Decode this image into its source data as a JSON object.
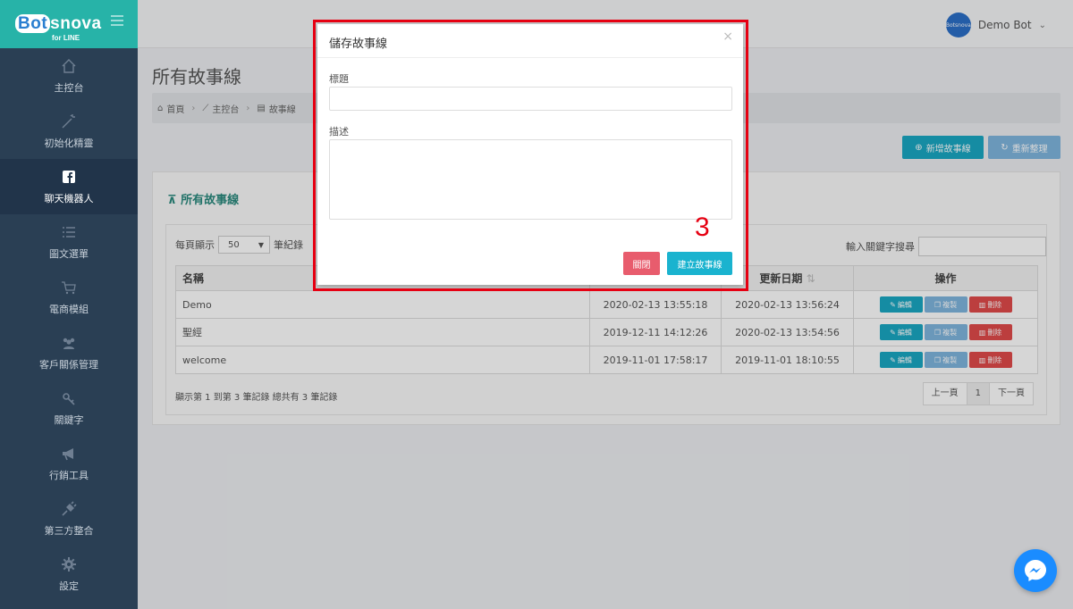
{
  "brand": {
    "logo_prefix": "Bot",
    "logo_rest": "snova",
    "logo_sub": "for LINE"
  },
  "sidebar": {
    "items": [
      {
        "label": "主控台",
        "icon": "home-icon"
      },
      {
        "label": "初始化精靈",
        "icon": "magic-wand-icon"
      },
      {
        "label": "聊天機器人",
        "icon": "facebook-square-icon",
        "active": true
      },
      {
        "label": "圖文選單",
        "icon": "list-icon"
      },
      {
        "label": "電商模組",
        "icon": "cart-icon"
      },
      {
        "label": "客戶關係管理",
        "icon": "users-icon"
      },
      {
        "label": "關鍵字",
        "icon": "key-icon"
      },
      {
        "label": "行銷工具",
        "icon": "megaphone-icon"
      },
      {
        "label": "第三方整合",
        "icon": "plug-icon"
      },
      {
        "label": "設定",
        "icon": "gear-icon"
      }
    ]
  },
  "topbar": {
    "user_name": "Demo Bot",
    "avatar_text": "Botsnova"
  },
  "page": {
    "title": "所有故事線"
  },
  "breadcrumb": {
    "home": "首頁",
    "console": "主控台",
    "current": "故事線"
  },
  "toolbar": {
    "add_label": "新增故事線",
    "refresh_label": "重新整理"
  },
  "panel": {
    "title": "所有故事線",
    "per_page_prefix": "每頁顯示",
    "per_page_value": "50",
    "per_page_suffix": "筆紀錄",
    "search_label": "輸入關鍵字搜尋"
  },
  "table": {
    "columns": {
      "name": "名稱",
      "updated": "更新日期",
      "ops": "操作"
    },
    "rows": [
      {
        "name": "Demo",
        "created": "2020-02-13 13:55:18",
        "updated": "2020-02-13 13:56:24"
      },
      {
        "name": "聖經",
        "created": "2019-12-11 14:12:26",
        "updated": "2020-02-13 13:54:56"
      },
      {
        "name": "welcome",
        "created": "2019-11-01 17:58:17",
        "updated": "2019-11-01 18:10:55"
      }
    ],
    "actions": {
      "edit": "編輯",
      "copy": "複製",
      "delete": "刪除"
    },
    "info": "顯示第 1 到第 3 筆記錄 總共有 3 筆記錄",
    "pager": {
      "prev": "上一頁",
      "current": "1",
      "next": "下一頁"
    }
  },
  "modal": {
    "title": "儲存故事線",
    "title_label": "標題",
    "desc_label": "描述",
    "close_button": "關閉",
    "create_button": "建立故事線",
    "annotation": "3"
  },
  "colors": {
    "accent": "#1aa7c3",
    "highlight": "#e60012",
    "sidebar": "#2a3f54"
  }
}
